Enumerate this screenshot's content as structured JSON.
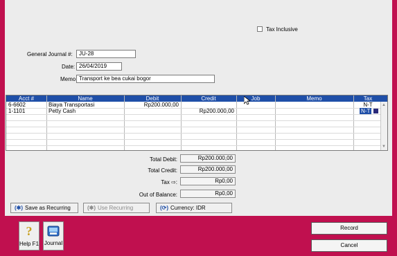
{
  "header": {
    "tax_inclusive_label": "Tax Inclusive"
  },
  "form": {
    "journal_label": "General Journal #:",
    "journal_value": "JU-28",
    "date_label": "Date:",
    "date_value": "26/04/2019",
    "memo_label": "Memo:",
    "memo_value": "Transport ke bea cukai bogor"
  },
  "grid": {
    "columns": [
      "Acct #",
      "Name",
      "Debit",
      "Credit",
      "Job",
      "Memo",
      "Tax"
    ],
    "rows": [
      {
        "acct": "6-6602",
        "name": "Biaya Transportasi",
        "debit": "Rp200.000,00",
        "credit": "",
        "job": "",
        "memo": "",
        "tax": "N-T"
      },
      {
        "acct": "1-1101",
        "name": "Petty Cash",
        "debit": "",
        "credit": "Rp200.000,00",
        "job": "",
        "memo": "",
        "tax": "N-T"
      }
    ]
  },
  "totals": {
    "total_debit_label": "Total Debit:",
    "total_debit": "Rp200.000,00",
    "total_credit_label": "Total Credit:",
    "total_credit": "Rp200.000,00",
    "tax_label": "Tax ⇨:",
    "tax": "Rp0,00",
    "oob_label": "Out of Balance:",
    "oob": "Rp0,00"
  },
  "buttons": {
    "save_recurring": "Save as Recurring",
    "use_recurring": "Use Recurring",
    "currency": "Currency: IDR",
    "record": "Record",
    "cancel": "Cancel",
    "help": "Help F1",
    "journal": "Journal"
  },
  "colors": {
    "background": "#c0104f",
    "header": "#1f4fa8"
  }
}
